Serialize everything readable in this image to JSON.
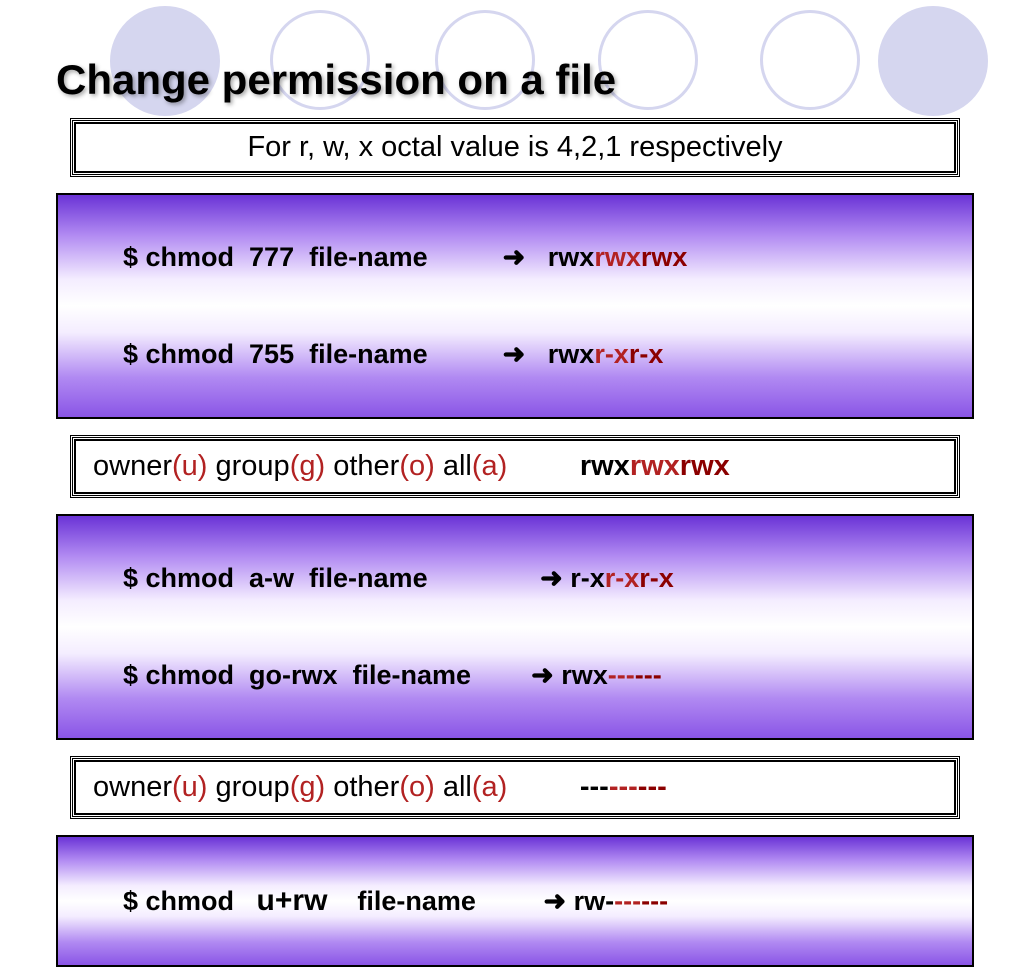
{
  "title": "Change permission on a file",
  "octal_note": "For r, w, x octal value is 4,2,1 respectively",
  "box1": {
    "line1_cmd": "$ chmod  777  file-name",
    "line1_arrow": "➜",
    "line1_p_owner": "rwx",
    "line1_p_group": "rwx",
    "line1_p_other": "rwx",
    "line2_cmd": "$ chmod  755  file-name",
    "line2_arrow": "➜",
    "line2_p_owner": "rwx",
    "line2_p_group": "r-x",
    "line2_p_other": "r-x"
  },
  "legend1": {
    "owner": "owner",
    "owner_p": "(u)",
    "group": "group",
    "group_p": "(g)",
    "other": "other",
    "other_p": "(o)",
    "all": "all",
    "all_p": "(a)",
    "perm_owner": "rwx",
    "perm_group": "rwx",
    "perm_other": "rwx"
  },
  "box2": {
    "line1_cmd": "$ chmod  a-w  file-name",
    "line1_arrow": "➜",
    "line1_p_owner": "r-x",
    "line1_p_group": "r-x",
    "line1_p_other": "r-x",
    "line2_cmd": "$ chmod  go-rwx  file-name",
    "line2_arrow": "➜",
    "line2_p_owner": "rwx",
    "line2_p_group": "---",
    "line2_p_other": "---"
  },
  "legend2": {
    "owner": "owner",
    "owner_p": "(u)",
    "group": "group",
    "group_p": "(g)",
    "other": "other",
    "other_p": "(o)",
    "all": "all",
    "all_p": "(a)",
    "perm_owner": "---",
    "perm_group": "---",
    "perm_other": "---"
  },
  "box3": {
    "cmd_pre": "$ chmod   ",
    "cmd_mode": "u+rw",
    "cmd_post": "    file-name",
    "arrow": "➜",
    "p_owner": "rw-",
    "p_group": "---",
    "p_other": "---"
  }
}
